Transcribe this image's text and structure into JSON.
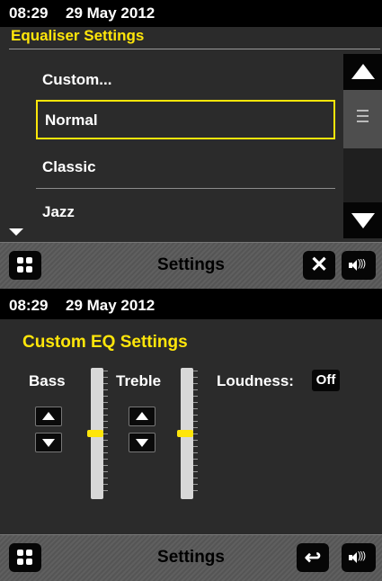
{
  "screens": [
    {
      "status": {
        "time": "08:29",
        "date": "29 May 2012"
      },
      "title": "Equaliser Settings",
      "items": [
        {
          "label": "Custom...",
          "selected": false
        },
        {
          "label": "Normal",
          "selected": true
        },
        {
          "label": "Classic",
          "selected": false
        },
        {
          "label": "Jazz",
          "selected": false
        }
      ],
      "bottom": {
        "title": "Settings",
        "left_icon": "menu-grid-icon",
        "right_icons": [
          "close-icon",
          "volume-icon"
        ]
      }
    },
    {
      "status": {
        "time": "08:29",
        "date": "29 May 2012"
      },
      "title": "Custom EQ Settings",
      "controls": {
        "bass_label": "Bass",
        "treble_label": "Treble",
        "loudness_label": "Loudness:",
        "loudness_value": "Off",
        "bass_level": 0,
        "treble_level": 0
      },
      "bottom": {
        "title": "Settings",
        "left_icon": "menu-grid-icon",
        "right_icons": [
          "back-icon",
          "volume-icon"
        ]
      }
    }
  ],
  "colors": {
    "accent": "#ffe60a",
    "background": "#2b2b2b",
    "statusbar": "#000000"
  }
}
